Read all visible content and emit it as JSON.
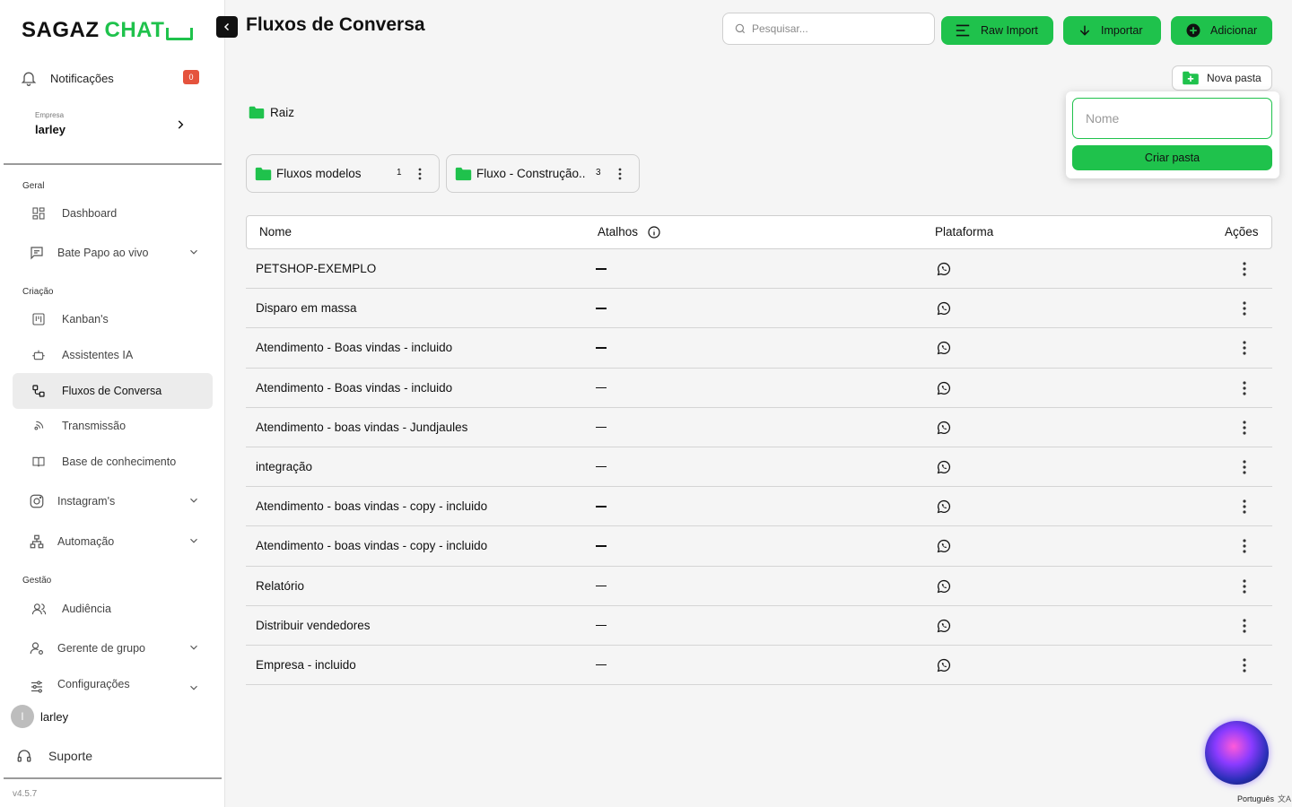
{
  "brand": {
    "part1": "SAGAZ",
    "part2": "CHAT"
  },
  "sidebar": {
    "notifications": {
      "label": "Notificações",
      "count": "0"
    },
    "company": {
      "caption": "Empresa",
      "name": "larley"
    },
    "sections": {
      "geral": "Geral",
      "criacao": "Criação",
      "gestao": "Gestão"
    },
    "items": {
      "dashboard": "Dashboard",
      "bate_papo": "Bate Papo ao vivo",
      "kanbans": "Kanban's",
      "assistentes": "Assistentes IA",
      "fluxos": "Fluxos de Conversa",
      "transmissao": "Transmissão",
      "base": "Base de conhecimento",
      "instagram": "Instagram's",
      "automacao": "Automação",
      "audiencia": "Audiência",
      "gerente": "Gerente de grupo",
      "config": "Configurações"
    },
    "user": {
      "initial": "l",
      "name": "larley"
    },
    "support": "Suporte",
    "version": "v4.5.7"
  },
  "header": {
    "title": "Fluxos de Conversa",
    "search_placeholder": "Pesquisar...",
    "raw_import": "Raw Import",
    "importar": "Importar",
    "adicionar": "Adicionar",
    "nova_pasta": "Nova pasta"
  },
  "popover": {
    "placeholder": "Nome",
    "create": "Criar pasta"
  },
  "breadcrumb": "Raiz",
  "folders": [
    {
      "name": "Fluxos modelos",
      "count": "1"
    },
    {
      "name": "Fluxo - Construção..",
      "count": "3"
    }
  ],
  "table": {
    "headers": {
      "nome": "Nome",
      "atalhos": "Atalhos",
      "plataforma": "Plataforma",
      "acoes": "Ações"
    },
    "rows": [
      "PETSHOP-EXEMPLO",
      "Disparo em massa",
      "Atendimento - Boas vindas - incluido",
      "Atendimento - Boas vindas - incluido",
      "Atendimento - boas vindas - Jundjaules",
      "integração",
      "Atendimento - boas vindas - copy - incluido",
      "Atendimento - boas vindas - copy - incluido",
      "Relatório",
      "Distribuir vendedores",
      "Empresa - incluido"
    ]
  },
  "language": "Português",
  "colors": {
    "accent": "#1fc24c",
    "badge": "#e5533d"
  }
}
